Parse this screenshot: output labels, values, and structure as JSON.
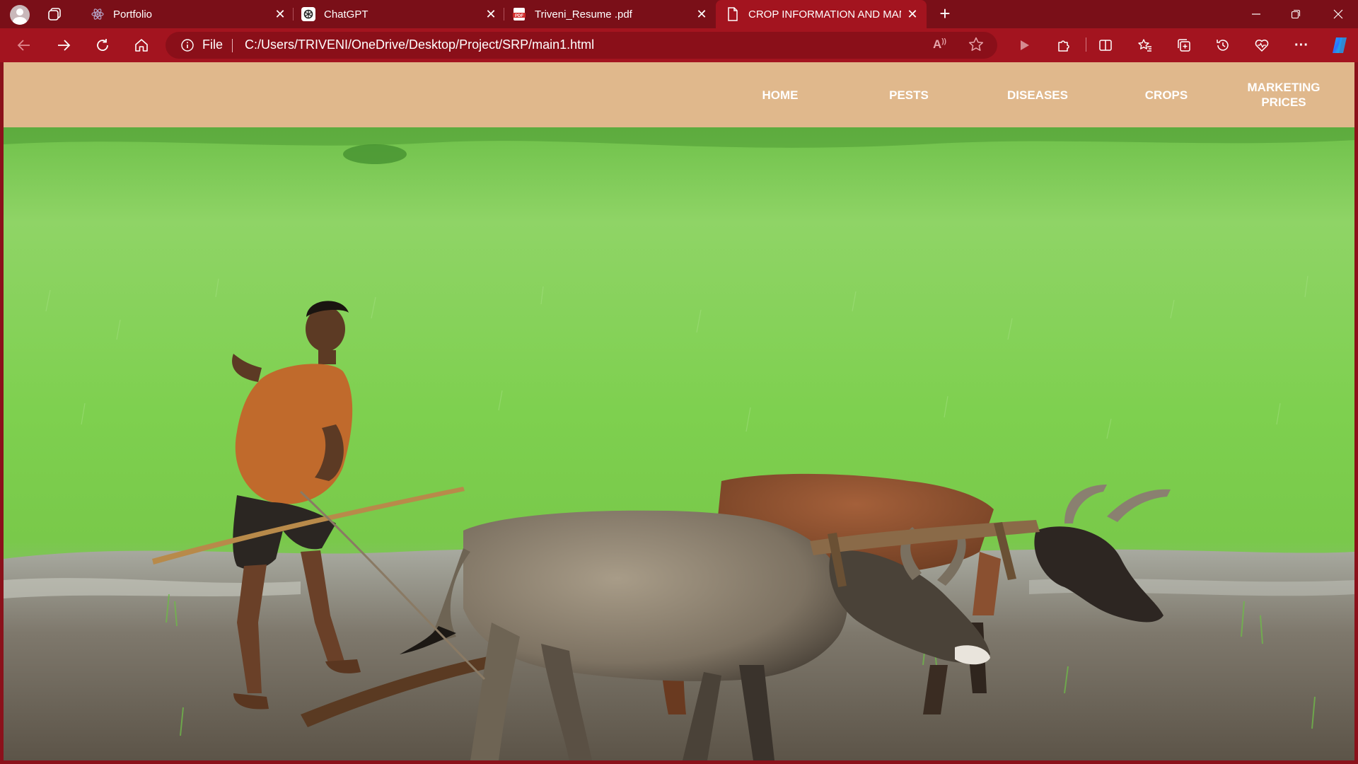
{
  "browser": {
    "tabs": [
      {
        "title": "Portfolio",
        "icon": "react-icon",
        "active": false
      },
      {
        "title": "ChatGPT",
        "icon": "chatgpt-icon",
        "active": false
      },
      {
        "title": "Triveni_Resume .pdf",
        "icon": "pdf-icon",
        "active": false
      },
      {
        "title": "CROP INFORMATION AND MAN",
        "icon": "page-icon",
        "active": true
      }
    ],
    "address": {
      "scheme": "File",
      "url": "C:/Users/TRIVENI/OneDrive/Desktop/Project/SRP/main1.html"
    },
    "colors": {
      "frame": "#7a0f18",
      "toolbar": "#a3141f",
      "active_tab": "#a3141f"
    }
  },
  "site": {
    "nav": {
      "items": [
        {
          "label": "HOME"
        },
        {
          "label": "PESTS"
        },
        {
          "label": "DISEASES"
        },
        {
          "label": "CROPS"
        },
        {
          "label": "MARKETING PRICES"
        }
      ],
      "color": "#e0b88c"
    },
    "hero": {
      "image": "farmer ploughing a muddy field with two oxen in front of green paddy grass"
    }
  }
}
